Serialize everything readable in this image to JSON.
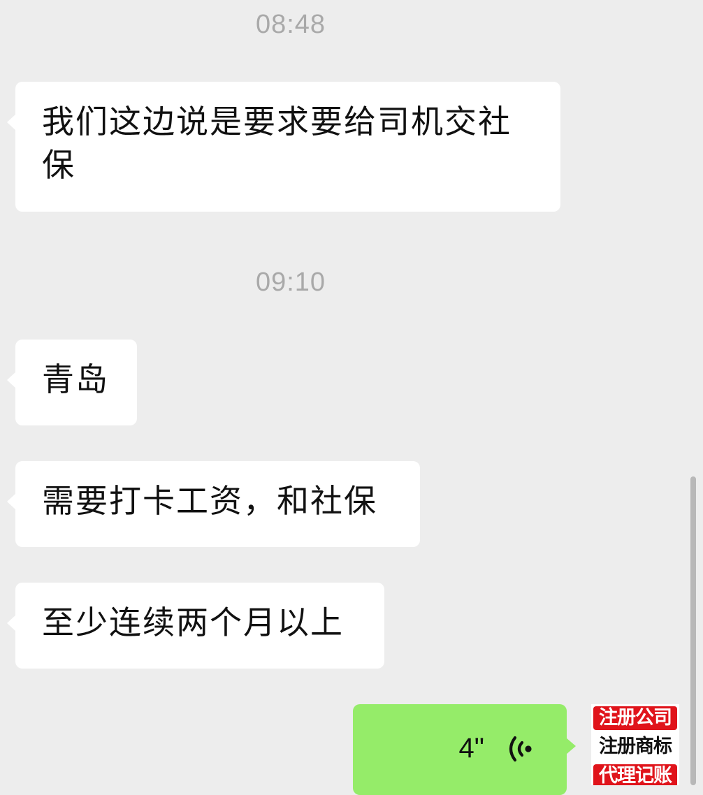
{
  "chat": {
    "timestamps": [
      "08:48",
      "09:10"
    ],
    "messages": [
      {
        "from": "other",
        "text": "我们这边说是要求要给司机交社保"
      },
      {
        "from": "other",
        "text": "青岛"
      },
      {
        "from": "other",
        "text": "需要打卡工资，和社保"
      },
      {
        "from": "other",
        "text": "至少连续两个月以上"
      },
      {
        "from": "me",
        "type": "voice",
        "duration": "4\"",
        "icon": "voice-wave-icon"
      }
    ]
  },
  "avatar": {
    "lines": [
      "注册公司",
      "注册商标",
      "代理记账"
    ]
  },
  "colors": {
    "background": "#ededed",
    "incoming_bubble": "#ffffff",
    "outgoing_bubble": "#95ec69",
    "timestamp_text": "#a9a9a9",
    "avatar_red": "#e0141b"
  }
}
